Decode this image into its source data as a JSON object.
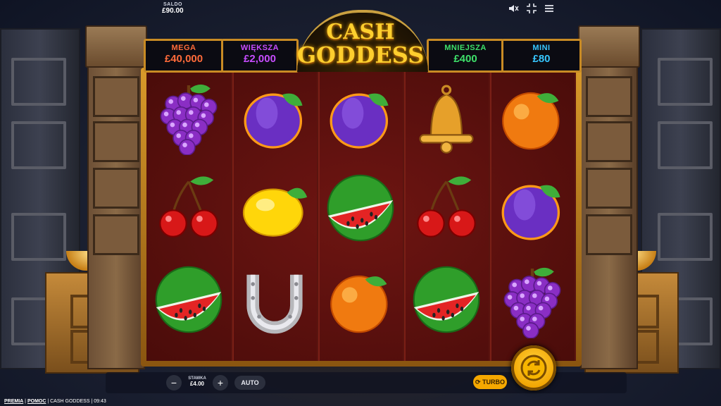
{
  "topbar": {
    "balance_label": "SALDO",
    "balance_value": "£90.00",
    "icons": [
      "sound-icon",
      "fullscreen-icon",
      "menu-icon"
    ]
  },
  "game": {
    "title_line1": "CASH",
    "title_line2": "GODDESS"
  },
  "jackpots": [
    {
      "label": "MEGA",
      "value": "£40,000",
      "label_color": "#ff6b3a",
      "value_color": "#ff6b3a"
    },
    {
      "label": "WIĘKSZA",
      "value": "£2,000",
      "label_color": "#c84dff",
      "value_color": "#c84dff"
    },
    {
      "label": "MNIEJSZA",
      "value": "£400",
      "label_color": "#3ee06a",
      "value_color": "#3ee06a"
    },
    {
      "label": "MINI",
      "value": "£80",
      "label_color": "#37c7ff",
      "value_color": "#37c7ff"
    }
  ],
  "reels": [
    [
      "grapes",
      "cherries",
      "watermelon"
    ],
    [
      "plum",
      "lemon",
      "horseshoe"
    ],
    [
      "plum",
      "watermelon",
      "orange"
    ],
    [
      "bell",
      "cherries",
      "watermelon"
    ],
    [
      "orange",
      "plum",
      "grapes"
    ]
  ],
  "controls": {
    "minus": "−",
    "plus": "+",
    "stake_label": "STAWKA",
    "stake_value": "£4.00",
    "auto_label": "AUTO",
    "turbo_label": "TURBO"
  },
  "footer": {
    "premia": "PREMIA",
    "pomoc": "POMOC",
    "game_name": "CASH GODDESS",
    "time": "09:43"
  }
}
